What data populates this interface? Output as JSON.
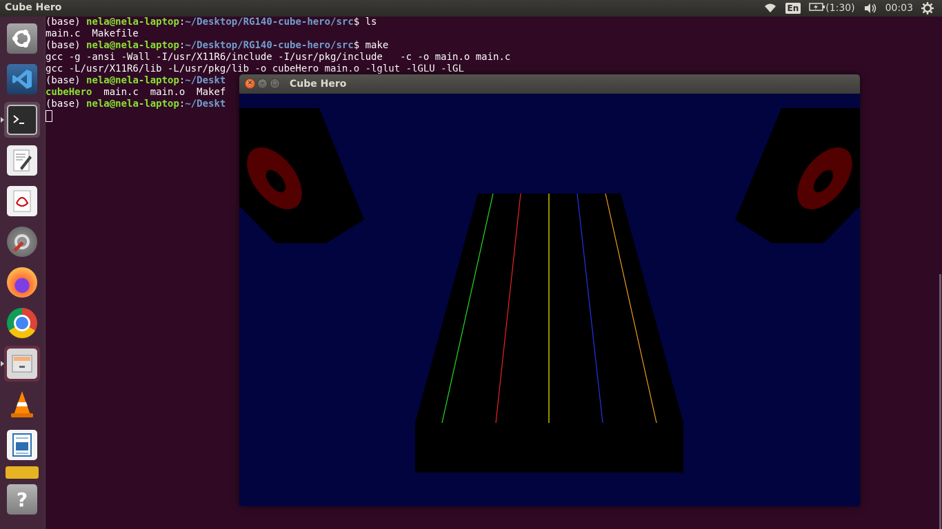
{
  "top_panel": {
    "app_title": "Cube Hero",
    "keyboard_layout": "En",
    "battery_text": "(1:30)",
    "clock": "00:03"
  },
  "launcher": {
    "items": [
      {
        "name": "ubuntu-dash",
        "icon": "ubuntu-logo-icon",
        "bg": "#8a8a8a"
      },
      {
        "name": "vscode",
        "icon": "vscode-icon",
        "bg": "#2b5a8a"
      },
      {
        "name": "terminal",
        "icon": "terminal-icon",
        "bg": "#2c2c2c",
        "active": true
      },
      {
        "name": "text-editor",
        "icon": "text-editor-icon",
        "bg": "#e8e8e8"
      },
      {
        "name": "pdf-reader",
        "icon": "pdf-reader-icon",
        "bg": "#e8e8e8"
      },
      {
        "name": "system-settings",
        "icon": "settings-icon",
        "bg": "#6a6a6a"
      },
      {
        "name": "firefox",
        "icon": "firefox-icon",
        "bg": "#e66000"
      },
      {
        "name": "chrome",
        "icon": "chrome-icon",
        "bg": "#ffffff"
      },
      {
        "name": "files",
        "icon": "file-cabinet-icon",
        "bg": "#c0505a"
      },
      {
        "name": "vlc",
        "icon": "vlc-cone-icon",
        "bg": "#f08a00"
      },
      {
        "name": "writer",
        "icon": "libreoffice-writer-icon",
        "bg": "#2e6fb0"
      },
      {
        "name": "help",
        "icon": "help-icon",
        "bg": "#8a8a8a"
      }
    ]
  },
  "terminal": {
    "prompt_env": "(base) ",
    "prompt_user": "nela@nela-laptop",
    "prompt_path": "~/Desktop/RG140-cube-hero/src",
    "prompt_path_cut": "~/Deskt",
    "cmd_ls": "ls",
    "ls_output_1": "main.c  Makefile",
    "cmd_make": "make",
    "make_output_1": "gcc -g -ansi -Wall -I/usr/X11R6/include -I/usr/pkg/include   -c -o main.o main.c",
    "make_output_2": "gcc -L/usr/X11R6/lib -L/usr/pkg/lib -o cubeHero main.o -lglut -lGLU -lGL",
    "ls_output_2_exe": "cubeHero",
    "ls_output_2_rest": "  main.c  main.o  Makef"
  },
  "game_window": {
    "title": "Cube Hero",
    "colors": {
      "background": "#01043f",
      "fretboard": "#000000",
      "speaker_cone": "#520000",
      "string_1": "#22dd22",
      "string_2": "#ee2222",
      "string_3": "#eeee00",
      "string_4": "#2233ee",
      "string_5": "#ee9922"
    }
  }
}
